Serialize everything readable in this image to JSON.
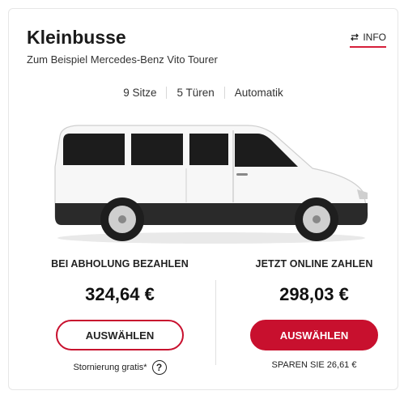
{
  "card": {
    "title": "Kleinbusse",
    "info_label": "INFO",
    "subtitle": "Zum Beispiel Mercedes-Benz Vito Tourer",
    "specs": [
      "9 Sitze",
      "5 Türen",
      "Automatik"
    ]
  },
  "pay_at_pickup": {
    "label": "BEI ABHOLUNG BEZAHLEN",
    "price": "324,64 €",
    "button": "AUSWÄHLEN",
    "note": "Stornierung gratis*",
    "help_symbol": "?"
  },
  "pay_online": {
    "label": "JETZT ONLINE ZAHLEN",
    "price": "298,03 €",
    "button": "AUSWÄHLEN",
    "note": "SPAREN SIE 26,61 €"
  },
  "colors": {
    "accent": "#c8102e",
    "border": "#e6e6e6"
  },
  "icons": {
    "info": "swap-arrows-icon",
    "help": "question-circle-icon"
  }
}
